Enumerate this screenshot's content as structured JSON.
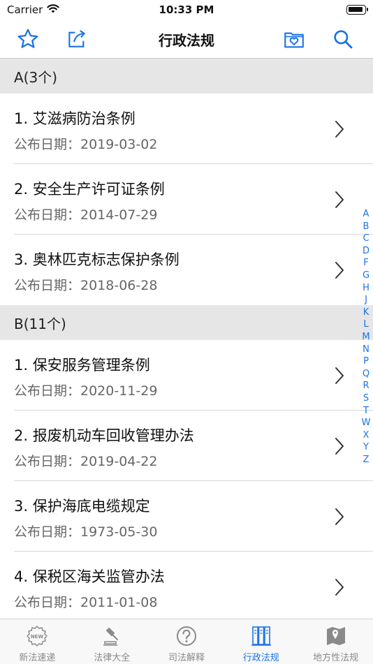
{
  "status_bar": {
    "carrier": "Carrier",
    "time": "10:33 PM"
  },
  "nav": {
    "title": "行政法规",
    "icons": [
      "star-icon",
      "share-icon",
      "favorites-folder-icon",
      "search-icon"
    ]
  },
  "sections": [
    {
      "header": "A(3个)",
      "items": [
        {
          "title": "1. 艾滋病防治条例",
          "date": "公布日期：2019-03-02"
        },
        {
          "title": "2. 安全生产许可证条例",
          "date": "公布日期：2014-07-29"
        },
        {
          "title": "3. 奥林匹克标志保护条例",
          "date": "公布日期：2018-06-28"
        }
      ]
    },
    {
      "header": "B(11个)",
      "items": [
        {
          "title": "1. 保安服务管理条例",
          "date": "公布日期：2020-11-29"
        },
        {
          "title": "2. 报废机动车回收管理办法",
          "date": "公布日期：2019-04-22"
        },
        {
          "title": "3. 保护海底电缆规定",
          "date": "公布日期：1973-05-30"
        },
        {
          "title": "4. 保税区海关监管办法",
          "date": "公布日期：2011-01-08"
        }
      ]
    }
  ],
  "index_letters": [
    "A",
    "B",
    "C",
    "D",
    "F",
    "G",
    "H",
    "J",
    "K",
    "L",
    "M",
    "N",
    "P",
    "Q",
    "R",
    "S",
    "T",
    "W",
    "X",
    "Y",
    "Z"
  ],
  "tabs": [
    {
      "label": "新法速递",
      "icon": "new-badge-icon",
      "active": false
    },
    {
      "label": "法律大全",
      "icon": "gavel-icon",
      "active": false
    },
    {
      "label": "司法解释",
      "icon": "question-circle-icon",
      "active": false
    },
    {
      "label": "行政法规",
      "icon": "document-stack-icon",
      "active": true
    },
    {
      "label": "地方性法规",
      "icon": "map-pin-icon",
      "active": false
    }
  ],
  "colors": {
    "accent": "#1a73e8",
    "section_bg": "#e6e6e6",
    "secondary_text": "#666666",
    "inactive_tab": "#8a8a8a"
  }
}
